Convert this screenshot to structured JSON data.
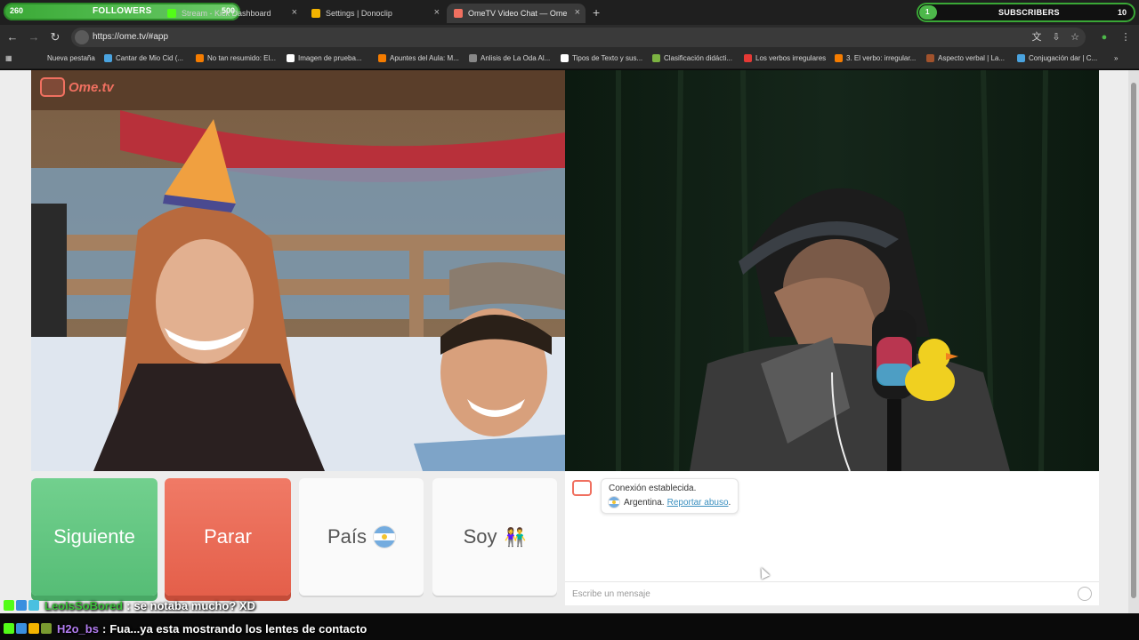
{
  "overlay": {
    "followers": {
      "left_count": "260",
      "label": "FOLLOWERS",
      "right_count": "500"
    },
    "subscribers": {
      "left_count": "1",
      "label": "SUBSCRIBERS",
      "right_count": "10"
    }
  },
  "tabs": [
    {
      "label": "Stream - Kick Dashboard",
      "active": false
    },
    {
      "label": "Settings | Donoclip",
      "active": false
    },
    {
      "label": "OmeTV Video Chat — Ome",
      "active": true
    }
  ],
  "toolbar": {
    "url": "https://ome.tv/#app"
  },
  "bookmarks": [
    "Nueva pestaña",
    "Cantar de Mio Cid (...",
    "No tan resumido: El...",
    "Imagen de prueba...",
    "Apuntes del Aula: M...",
    "Anlisis de La Oda Al...",
    "Tipos de Texto y sus...",
    "Clasificación didácti...",
    "Los verbos irregulares",
    "3. El verbo: irregular...",
    "Aspecto verbal | La...",
    "Conjugación dar | C..."
  ],
  "logo": {
    "word": "Ome.tv"
  },
  "buttons": {
    "next": "Siguiente",
    "stop": "Parar",
    "country": "País",
    "gender": "Soy"
  },
  "chat": {
    "status": "Conexión establecida.",
    "country": "Argentina.",
    "report": "Reportar abuso",
    "report_suffix": ".",
    "placeholder": "Escribe un mensaje"
  },
  "stream_chat": [
    {
      "user": "LeoIsSoBored",
      "sep": ":",
      "message": "se notaba mucho? XD"
    },
    {
      "user": "H2o_bs",
      "sep": ":",
      "message": "Fua...ya esta mostrando los lentes de contacto"
    }
  ],
  "colors": {
    "accent_green": "#4db84a",
    "next_green": "#5bc27b",
    "stop_red": "#e8604c",
    "link_blue": "#3a8fbf"
  }
}
